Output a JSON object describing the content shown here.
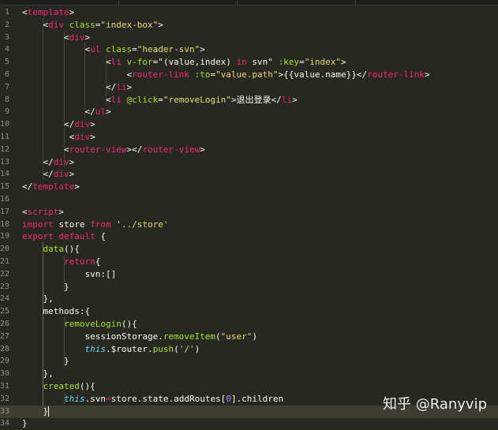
{
  "colors": {
    "background": "#272822",
    "tag": "#f92672",
    "attribute": "#a6e22e",
    "string": "#e6db74",
    "keyword": "#66d9ef",
    "line_number": "#8f908a"
  },
  "lines": [
    {
      "num": "1",
      "tokens": [
        [
          "p",
          "<"
        ],
        [
          "t",
          "template"
        ],
        [
          "p",
          ">"
        ]
      ]
    },
    {
      "num": "2",
      "tokens": [
        [
          "p",
          "    <"
        ],
        [
          "t",
          "div"
        ],
        [
          "p",
          " "
        ],
        [
          "a",
          "class"
        ],
        [
          "p",
          "="
        ],
        [
          "s",
          "\"index-box\""
        ],
        [
          "p",
          ">"
        ]
      ]
    },
    {
      "num": "3",
      "tokens": [
        [
          "p",
          "        <"
        ],
        [
          "t",
          "div"
        ],
        [
          "p",
          ">"
        ]
      ]
    },
    {
      "num": "4",
      "tokens": [
        [
          "p",
          "            <"
        ],
        [
          "t",
          "ul"
        ],
        [
          "p",
          " "
        ],
        [
          "a",
          "class"
        ],
        [
          "p",
          "="
        ],
        [
          "s",
          "\"header-svn\""
        ],
        [
          "p",
          ">"
        ]
      ]
    },
    {
      "num": "5",
      "tokens": [
        [
          "p",
          "                <"
        ],
        [
          "t",
          "li"
        ],
        [
          "p",
          " "
        ],
        [
          "a",
          "v-for"
        ],
        [
          "p",
          "=\"(value,index) "
        ],
        [
          "o",
          "in"
        ],
        [
          "p",
          " svn\" "
        ],
        [
          "a",
          ":key"
        ],
        [
          "p",
          "="
        ],
        [
          "s",
          "\"index\""
        ],
        [
          "p",
          ">"
        ]
      ]
    },
    {
      "num": "6",
      "tokens": [
        [
          "p",
          "                    <"
        ],
        [
          "t",
          "router-link"
        ],
        [
          "p",
          " "
        ],
        [
          "a",
          ":to"
        ],
        [
          "p",
          "="
        ],
        [
          "s",
          "\"value.path\""
        ],
        [
          "p",
          ">{{value.name}}</"
        ],
        [
          "t",
          "router-link"
        ],
        [
          "p",
          ">"
        ]
      ]
    },
    {
      "num": "7",
      "tokens": [
        [
          "p",
          "                </"
        ],
        [
          "t",
          "li"
        ],
        [
          "p",
          ">"
        ]
      ]
    },
    {
      "num": "8",
      "tokens": [
        [
          "p",
          "                <"
        ],
        [
          "t",
          "li"
        ],
        [
          "p",
          " "
        ],
        [
          "a",
          "@click"
        ],
        [
          "p",
          "="
        ],
        [
          "s",
          "\"removeLogin\""
        ],
        [
          "p",
          ">退出登录</"
        ],
        [
          "t",
          "li"
        ],
        [
          "p",
          ">"
        ]
      ]
    },
    {
      "num": "9",
      "tokens": [
        [
          "p",
          "            </"
        ],
        [
          "t",
          "ul"
        ],
        [
          "p",
          ">"
        ]
      ]
    },
    {
      "num": "10",
      "tokens": [
        [
          "p",
          "        </"
        ],
        [
          "t",
          "div"
        ],
        [
          "p",
          ">"
        ]
      ]
    },
    {
      "num": "11",
      "tokens": [
        [
          "p",
          "         <"
        ],
        [
          "t",
          "div"
        ],
        [
          "p",
          ">"
        ]
      ]
    },
    {
      "num": "12",
      "tokens": [
        [
          "p",
          "        <"
        ],
        [
          "t",
          "router-view"
        ],
        [
          "p",
          "></"
        ],
        [
          "t",
          "router-view"
        ],
        [
          "p",
          ">"
        ]
      ]
    },
    {
      "num": "13",
      "tokens": [
        [
          "p",
          "    </"
        ],
        [
          "t",
          "div"
        ],
        [
          "p",
          ">"
        ]
      ]
    },
    {
      "num": "14",
      "tokens": [
        [
          "p",
          "    </"
        ],
        [
          "t",
          "div"
        ],
        [
          "p",
          ">"
        ]
      ]
    },
    {
      "num": "15",
      "tokens": [
        [
          "p",
          "</"
        ],
        [
          "t",
          "template"
        ],
        [
          "p",
          ">"
        ]
      ]
    },
    {
      "num": "16",
      "tokens": []
    },
    {
      "num": "17",
      "tokens": [
        [
          "p",
          "<"
        ],
        [
          "t",
          "script"
        ],
        [
          "p",
          ">"
        ]
      ]
    },
    {
      "num": "18",
      "tokens": [
        [
          "o",
          "import"
        ],
        [
          "p",
          " store "
        ],
        [
          "o",
          "from"
        ],
        [
          "p",
          " "
        ],
        [
          "s",
          "'../store'"
        ]
      ]
    },
    {
      "num": "19",
      "tokens": [
        [
          "o",
          "export"
        ],
        [
          "p",
          " "
        ],
        [
          "o",
          "default"
        ],
        [
          "p",
          " {"
        ]
      ]
    },
    {
      "num": "20",
      "tokens": [
        [
          "p",
          "    "
        ],
        [
          "f",
          "data"
        ],
        [
          "p",
          "(){"
        ]
      ]
    },
    {
      "num": "21",
      "tokens": [
        [
          "p",
          "        "
        ],
        [
          "o",
          "return"
        ],
        [
          "p",
          "{"
        ]
      ]
    },
    {
      "num": "22",
      "tokens": [
        [
          "p",
          "            svn:[]"
        ]
      ]
    },
    {
      "num": "23",
      "tokens": [
        [
          "p",
          "        }"
        ]
      ]
    },
    {
      "num": "24",
      "tokens": [
        [
          "p",
          "    },"
        ]
      ]
    },
    {
      "num": "25",
      "tokens": [
        [
          "p",
          "    methods:{"
        ]
      ]
    },
    {
      "num": "26",
      "tokens": [
        [
          "p",
          "        "
        ],
        [
          "f",
          "removeLogin"
        ],
        [
          "p",
          "(){"
        ]
      ]
    },
    {
      "num": "27",
      "tokens": [
        [
          "p",
          "            sessionStorage."
        ],
        [
          "f",
          "removeItem"
        ],
        [
          "p",
          "("
        ],
        [
          "s",
          "\"user\""
        ],
        [
          "p",
          ")"
        ]
      ]
    },
    {
      "num": "28",
      "tokens": [
        [
          "p",
          "            "
        ],
        [
          "k",
          "this"
        ],
        [
          "p",
          ".$router."
        ],
        [
          "f",
          "push"
        ],
        [
          "p",
          "("
        ],
        [
          "s",
          "'/'"
        ],
        [
          "p",
          ")"
        ]
      ]
    },
    {
      "num": "29",
      "tokens": [
        [
          "p",
          "        }"
        ]
      ]
    },
    {
      "num": "30",
      "tokens": [
        [
          "p",
          "    },"
        ]
      ]
    },
    {
      "num": "31",
      "tokens": [
        [
          "p",
          "    "
        ],
        [
          "f",
          "created"
        ],
        [
          "p",
          "(){"
        ]
      ]
    },
    {
      "num": "32",
      "tokens": [
        [
          "p",
          "        "
        ],
        [
          "k",
          "this"
        ],
        [
          "p",
          ".svn"
        ],
        [
          "o",
          "="
        ],
        [
          "p",
          "store.state.addRoutes["
        ],
        [
          "n",
          "0"
        ],
        [
          "p",
          "].children"
        ]
      ]
    },
    {
      "num": "33",
      "tokens": [
        [
          "p",
          "    }"
        ]
      ]
    },
    {
      "num": "34",
      "tokens": [
        [
          "p",
          "}"
        ]
      ]
    }
  ],
  "watermark": "知乎 @Ranyvip"
}
